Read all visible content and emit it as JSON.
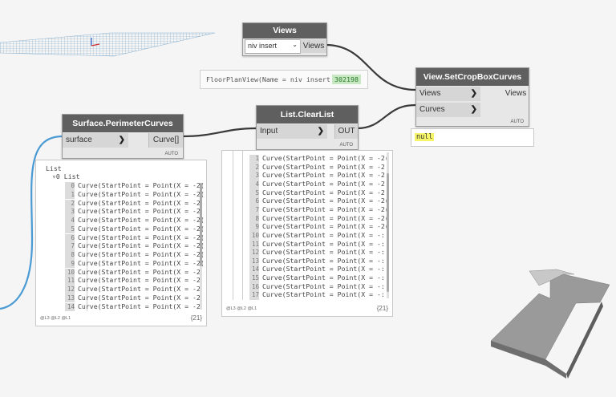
{
  "canvas": {
    "background": "#f5f5f5",
    "wire_color": "#3a3a3a",
    "input_wire_color": "#4a9ad4"
  },
  "nodes": {
    "views": {
      "title": "Views",
      "dropdown_value": "niv insert",
      "output": "Views"
    },
    "views_preview": {
      "text": "FloorPlanView(Name = niv insert )",
      "id_badge": "302198"
    },
    "set_crop": {
      "title": "View.SetCropBoxCurves",
      "input1": "Views",
      "input2": "Curves",
      "output": "Views",
      "auto": "AUTO"
    },
    "set_crop_preview": {
      "text": "null"
    },
    "clear_list": {
      "title": "List.ClearList",
      "input": "Input",
      "output": "OUT",
      "auto": "AUTO"
    },
    "perimeter": {
      "title": "Surface.PerimeterCurves",
      "input": "surface",
      "output": "Curve[]",
      "auto": "AUTO"
    }
  },
  "perimeter_preview": {
    "root": "List",
    "sub": "▿0 List",
    "items": [
      {
        "i": "0",
        "t": "Curve(StartPoint = Point(X = -2("
      },
      {
        "i": "1",
        "t": "Curve(StartPoint = Point(X = -2("
      },
      {
        "i": "2",
        "t": "Curve(StartPoint = Point(X = -2"
      },
      {
        "i": "3",
        "t": "Curve(StartPoint = Point(X = -2"
      },
      {
        "i": "4",
        "t": "Curve(StartPoint = Point(X = -2("
      },
      {
        "i": "5",
        "t": "Curve(StartPoint = Point(X = -2("
      },
      {
        "i": "6",
        "t": "Curve(StartPoint = Point(X = -2("
      },
      {
        "i": "7",
        "t": "Curve(StartPoint = Point(X = -2("
      },
      {
        "i": "8",
        "t": "Curve(StartPoint = Point(X = -2("
      },
      {
        "i": "9",
        "t": "Curve(StartPoint = Point(X = -2("
      },
      {
        "i": "10",
        "t": "Curve(StartPoint = Point(X = -2"
      },
      {
        "i": "11",
        "t": "Curve(StartPoint = Point(X = -2"
      },
      {
        "i": "12",
        "t": "Curve(StartPoint = Point(X = -2"
      },
      {
        "i": "13",
        "t": "Curve(StartPoint = Point(X = -2"
      },
      {
        "i": "14",
        "t": "Curve(StartPoint = Point(X = -2"
      }
    ],
    "footer_levels": "@L3 @L2 @L1",
    "count": "{21}"
  },
  "clear_preview": {
    "items": [
      {
        "i": "1",
        "t": "Curve(StartPoint = Point(X = -2("
      },
      {
        "i": "2",
        "t": "Curve(StartPoint = Point(X = -2"
      },
      {
        "i": "3",
        "t": "Curve(StartPoint = Point(X = -2"
      },
      {
        "i": "4",
        "t": "Curve(StartPoint = Point(X = -2"
      },
      {
        "i": "5",
        "t": "Curve(StartPoint = Point(X = -2"
      },
      {
        "i": "6",
        "t": "Curve(StartPoint = Point(X = -2("
      },
      {
        "i": "7",
        "t": "Curve(StartPoint = Point(X = -2("
      },
      {
        "i": "8",
        "t": "Curve(StartPoint = Point(X = -2("
      },
      {
        "i": "9",
        "t": "Curve(StartPoint = Point(X = -2("
      },
      {
        "i": "10",
        "t": "Curve(StartPoint = Point(X = -:"
      },
      {
        "i": "11",
        "t": "Curve(StartPoint = Point(X = -:"
      },
      {
        "i": "12",
        "t": "Curve(StartPoint = Point(X = -:"
      },
      {
        "i": "13",
        "t": "Curve(StartPoint = Point(X = -:"
      },
      {
        "i": "14",
        "t": "Curve(StartPoint = Point(X = -:"
      },
      {
        "i": "15",
        "t": "Curve(StartPoint = Point(X = -:"
      },
      {
        "i": "16",
        "t": "Curve(StartPoint = Point(X = -:"
      },
      {
        "i": "17",
        "t": "Curve(StartPoint = Point(X = -:"
      }
    ],
    "footer_levels": "@L3 @L2 @L1",
    "count": "{21}"
  }
}
